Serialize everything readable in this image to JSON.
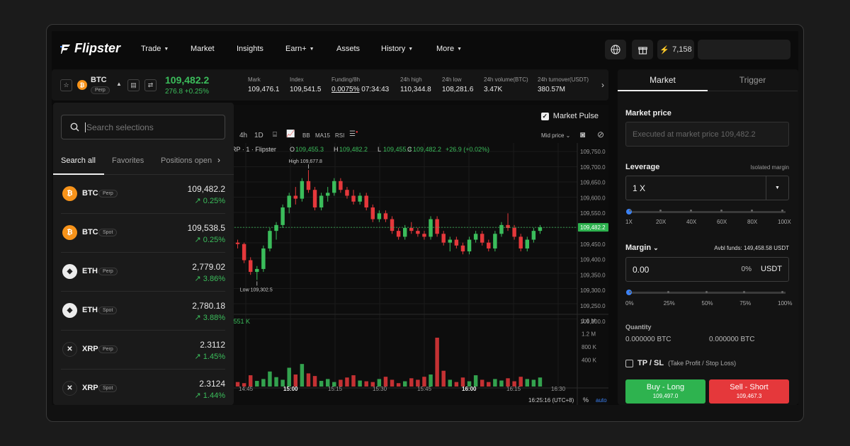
{
  "brand": "Flipster",
  "nav": {
    "items": [
      {
        "label": "Trade",
        "caret": true
      },
      {
        "label": "Market",
        "caret": false
      },
      {
        "label": "Insights",
        "caret": false
      },
      {
        "label": "Earn+",
        "caret": true
      },
      {
        "label": "Assets",
        "caret": false
      },
      {
        "label": "History",
        "caret": true
      },
      {
        "label": "More",
        "caret": true
      }
    ],
    "points": "7,158"
  },
  "ticker": {
    "symbol": "BTC",
    "type": "Perp",
    "price": "109,482.2",
    "change": "276.8 +0.25%",
    "stats": [
      {
        "label": "Mark",
        "value": "109,476.1"
      },
      {
        "label": "Index",
        "value": "109,541.5"
      },
      {
        "label": "Funding/8h",
        "value": "0.0075%",
        "extra": "07:34:43"
      },
      {
        "label": "24h high",
        "value": "110,344.8"
      },
      {
        "label": "24h low",
        "value": "108,281.6"
      },
      {
        "label": "24h volume(BTC)",
        "value": "3.47K"
      },
      {
        "label": "24h turnover(USDT)",
        "value": "380.57M"
      }
    ]
  },
  "selector": {
    "search_placeholder": "Search selections",
    "tabs": [
      "Search all",
      "Favorites",
      "Positions open"
    ],
    "rows": [
      {
        "symbol": "BTC",
        "type": "Perp",
        "price": "109,482.2",
        "change": "↗ 0.25%",
        "coin": "btc"
      },
      {
        "symbol": "BTC",
        "type": "Spot",
        "price": "109,538.5",
        "change": "↗ 0.25%",
        "coin": "btc"
      },
      {
        "symbol": "ETH",
        "type": "Perp",
        "price": "2,779.02",
        "change": "↗ 3.86%",
        "coin": "eth"
      },
      {
        "symbol": "ETH",
        "type": "Spot",
        "price": "2,780.18",
        "change": "↗ 3.88%",
        "coin": "eth"
      },
      {
        "symbol": "XRP",
        "type": "Perp",
        "price": "2.3112",
        "change": "↗ 1.45%",
        "coin": "xrp"
      },
      {
        "symbol": "XRP",
        "type": "Spot",
        "price": "2.3124",
        "change": "↗ 1.44%",
        "coin": "xrp"
      }
    ]
  },
  "chart": {
    "market_pulse": "Market Pulse",
    "toolbar": {
      "intervals": [
        "4h",
        "1D"
      ],
      "indicators": [
        "BB",
        "MA15",
        "RSI"
      ],
      "mid_price": "Mid price"
    },
    "ohlc_prefix": "RP · 1 · Flipster",
    "ohlc": {
      "o": "109,455.3",
      "h": "109,482.2",
      "l": "109,455.3",
      "c": "109,482.2",
      "chg": "+26.9 (+0.02%)"
    },
    "high_label": "High 109,677.8",
    "low_label": "Low 109,302.5",
    "current_price": "109,482.2",
    "volume_label": ".551 K",
    "price_axis": [
      "109,750.0",
      "109,700.0",
      "109,650.0",
      "109,600.0",
      "109,550.0",
      "109,500.0",
      "109,450.0",
      "109,400.0",
      "109,350.0",
      "109,300.0",
      "109,250.0",
      "109,200.0"
    ],
    "volume_axis": [
      "1.6 M",
      "1.2 M",
      "800 K",
      "400 K"
    ],
    "time_axis": [
      "14:45",
      "15:00",
      "15:15",
      "15:30",
      "15:45",
      "16:00",
      "16:15",
      "16:30"
    ],
    "clock": "16:25:16 (UTC+8)",
    "percent": "%",
    "auto": "auto"
  },
  "chart_data": {
    "type": "candlestick",
    "title": "",
    "ylim": [
      109190,
      109770
    ],
    "x_ticks": [
      "14:45",
      "15:00",
      "15:15",
      "15:30",
      "15:45",
      "16:00",
      "16:15",
      "16:30"
    ],
    "candles": [
      [
        109430,
        109440,
        109410,
        109425
      ],
      [
        109425,
        109430,
        109360,
        109370
      ],
      [
        109370,
        109380,
        109320,
        109330
      ],
      [
        109330,
        109350,
        109302.5,
        109340
      ],
      [
        109340,
        109420,
        109330,
        109410
      ],
      [
        109410,
        109480,
        109400,
        109470
      ],
      [
        109470,
        109500,
        109440,
        109490
      ],
      [
        109490,
        109560,
        109480,
        109550
      ],
      [
        109550,
        109600,
        109530,
        109590
      ],
      [
        109590,
        109620,
        109560,
        109580
      ],
      [
        109580,
        109650,
        109570,
        109640
      ],
      [
        109640,
        109677.8,
        109600,
        109610
      ],
      [
        109610,
        109620,
        109540,
        109550
      ],
      [
        109550,
        109600,
        109540,
        109590
      ],
      [
        109590,
        109620,
        109570,
        109600
      ],
      [
        109600,
        109650,
        109590,
        109640
      ],
      [
        109640,
        109650,
        109600,
        109610
      ],
      [
        109610,
        109620,
        109580,
        109590
      ],
      [
        109590,
        109610,
        109560,
        109570
      ],
      [
        109570,
        109600,
        109560,
        109590
      ],
      [
        109590,
        109600,
        109540,
        109550
      ],
      [
        109550,
        109560,
        109500,
        109510
      ],
      [
        109510,
        109540,
        109500,
        109530
      ],
      [
        109530,
        109540,
        109500,
        109510
      ],
      [
        109510,
        109520,
        109460,
        109470
      ],
      [
        109470,
        109480,
        109440,
        109450
      ],
      [
        109450,
        109490,
        109440,
        109480
      ],
      [
        109480,
        109500,
        109460,
        109470
      ],
      [
        109470,
        109480,
        109450,
        109460
      ],
      [
        109460,
        109470,
        109440,
        109450
      ],
      [
        109450,
        109520,
        109440,
        109510
      ],
      [
        109510,
        109520,
        109450,
        109460
      ],
      [
        109460,
        109470,
        109420,
        109430
      ],
      [
        109430,
        109450,
        109400,
        109440
      ],
      [
        109440,
        109450,
        109410,
        109420
      ],
      [
        109420,
        109430,
        109390,
        109400
      ],
      [
        109400,
        109450,
        109390,
        109440
      ],
      [
        109440,
        109470,
        109430,
        109460
      ],
      [
        109460,
        109470,
        109420,
        109430
      ],
      [
        109430,
        109440,
        109400,
        109410
      ],
      [
        109410,
        109470,
        109400,
        109460
      ],
      [
        109460,
        109500,
        109450,
        109490
      ],
      [
        109490,
        109530,
        109470,
        109480
      ],
      [
        109480,
        109490,
        109440,
        109450
      ],
      [
        109450,
        109460,
        109400,
        109410
      ],
      [
        109410,
        109450,
        109400,
        109440
      ],
      [
        109440,
        109480,
        109430,
        109470
      ],
      [
        109470,
        109490,
        109460,
        109482.2
      ]
    ],
    "volumes": [
      120,
      90,
      300,
      150,
      200,
      400,
      250,
      180,
      500,
      320,
      600,
      350,
      280,
      150,
      200,
      120,
      180,
      240,
      300,
      160,
      140,
      120,
      200,
      260,
      180,
      90,
      140,
      220,
      180,
      260,
      320,
      1300,
      420,
      180,
      120,
      240,
      140,
      300,
      180,
      120,
      200,
      160,
      220,
      140,
      260,
      200,
      180,
      240
    ]
  },
  "order": {
    "tabs": [
      "Market",
      "Trigger"
    ],
    "market_price_label": "Market price",
    "market_price_placeholder": "Executed at market price 109,482.2",
    "leverage_label": "Leverage",
    "leverage_mode": "Isolated margin",
    "leverage_value": "1 X",
    "leverage_ticks": [
      "1X",
      "20X",
      "40X",
      "60X",
      "80X",
      "100X"
    ],
    "margin_label": "Margin",
    "avbl": "Avbl funds: 149,458.58 USDT",
    "margin_value": "0.00",
    "margin_pct": "0%",
    "margin_unit": "USDT",
    "margin_ticks": [
      "0%",
      "25%",
      "50%",
      "75%",
      "100%"
    ],
    "quantity_label": "Quantity",
    "qty_long": "0.000000 BTC",
    "qty_short": "0.000000 BTC",
    "tpsl_label": "TP / SL",
    "tpsl_desc": "(Take Profit / Stop Loss)",
    "buy_label": "Buy - Long",
    "buy_price": "109,497.0",
    "sell_label": "Sell - Short",
    "sell_price": "109,467.3"
  },
  "colors": {
    "up": "#3bbd5b",
    "down": "#e5383b",
    "accent": "#3b82f6"
  }
}
